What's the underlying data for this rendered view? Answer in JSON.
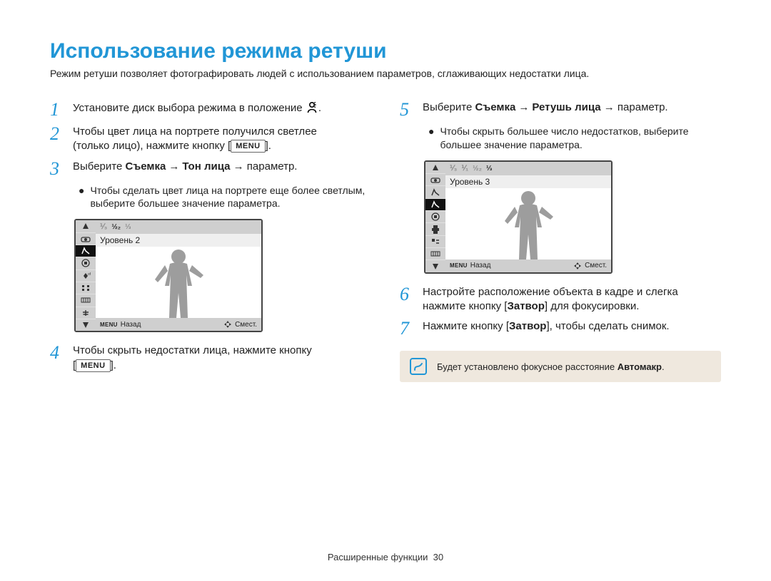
{
  "title": "Использование режима ретуши",
  "intro": "Режим ретуши позволяет фотографировать людей с использованием параметров, сглаживающих недостатки лица.",
  "left": {
    "step1": {
      "num": "1",
      "text": "Установите диск выбора режима в положение",
      "mode_icon": "beauty-mode-icon",
      "tail": "."
    },
    "step2": {
      "num": "2",
      "line1": "Чтобы цвет лица на портрете получился светлее",
      "line2_pre": "(только лицо), нажмите кнопку [",
      "menu": "MENU",
      "line2_post": "]."
    },
    "step3": {
      "num": "3",
      "pre": "Выберите ",
      "b1": "Съемка",
      "arrow": "→",
      "b2": "Тон лица",
      "post": " → параметр."
    },
    "step3_bullet": "Чтобы сделать цвет лица на портрете еще более светлым, выберите большее значение параметра.",
    "screenshot": {
      "level_label": "Уровень 2",
      "back_label": "Назад",
      "move_label": "Смест."
    },
    "step4": {
      "num": "4",
      "line1": "Чтобы скрыть недостатки лица, нажмите кнопку",
      "line2_pre": "[",
      "menu": "MENU",
      "line2_post": "]."
    }
  },
  "right": {
    "step5": {
      "num": "5",
      "pre": "Выберите ",
      "b1": "Съемка",
      "arrow": "→",
      "b2": "Ретушь лица",
      "post": " → параметр."
    },
    "step5_bullet": "Чтобы скрыть большее число недостатков, выберите большее значение параметра.",
    "screenshot": {
      "level_label": "Уровень 3",
      "back_label": "Назад",
      "move_label": "Смест."
    },
    "step6": {
      "num": "6",
      "line1": "Настройте расположение объекта в кадре и слегка",
      "line2_pre": "нажмите кнопку [",
      "b": "Затвор",
      "line2_post": "] для фокусировки."
    },
    "step7": {
      "num": "7",
      "pre": "Нажмите кнопку [",
      "b": "Затвор",
      "post": "], чтобы сделать снимок."
    },
    "note": {
      "pre": "Будет установлено фокусное расстояние ",
      "b": "Автомакр",
      "post": "."
    }
  },
  "footer": {
    "section": "Расширенные функции",
    "page": "30"
  }
}
